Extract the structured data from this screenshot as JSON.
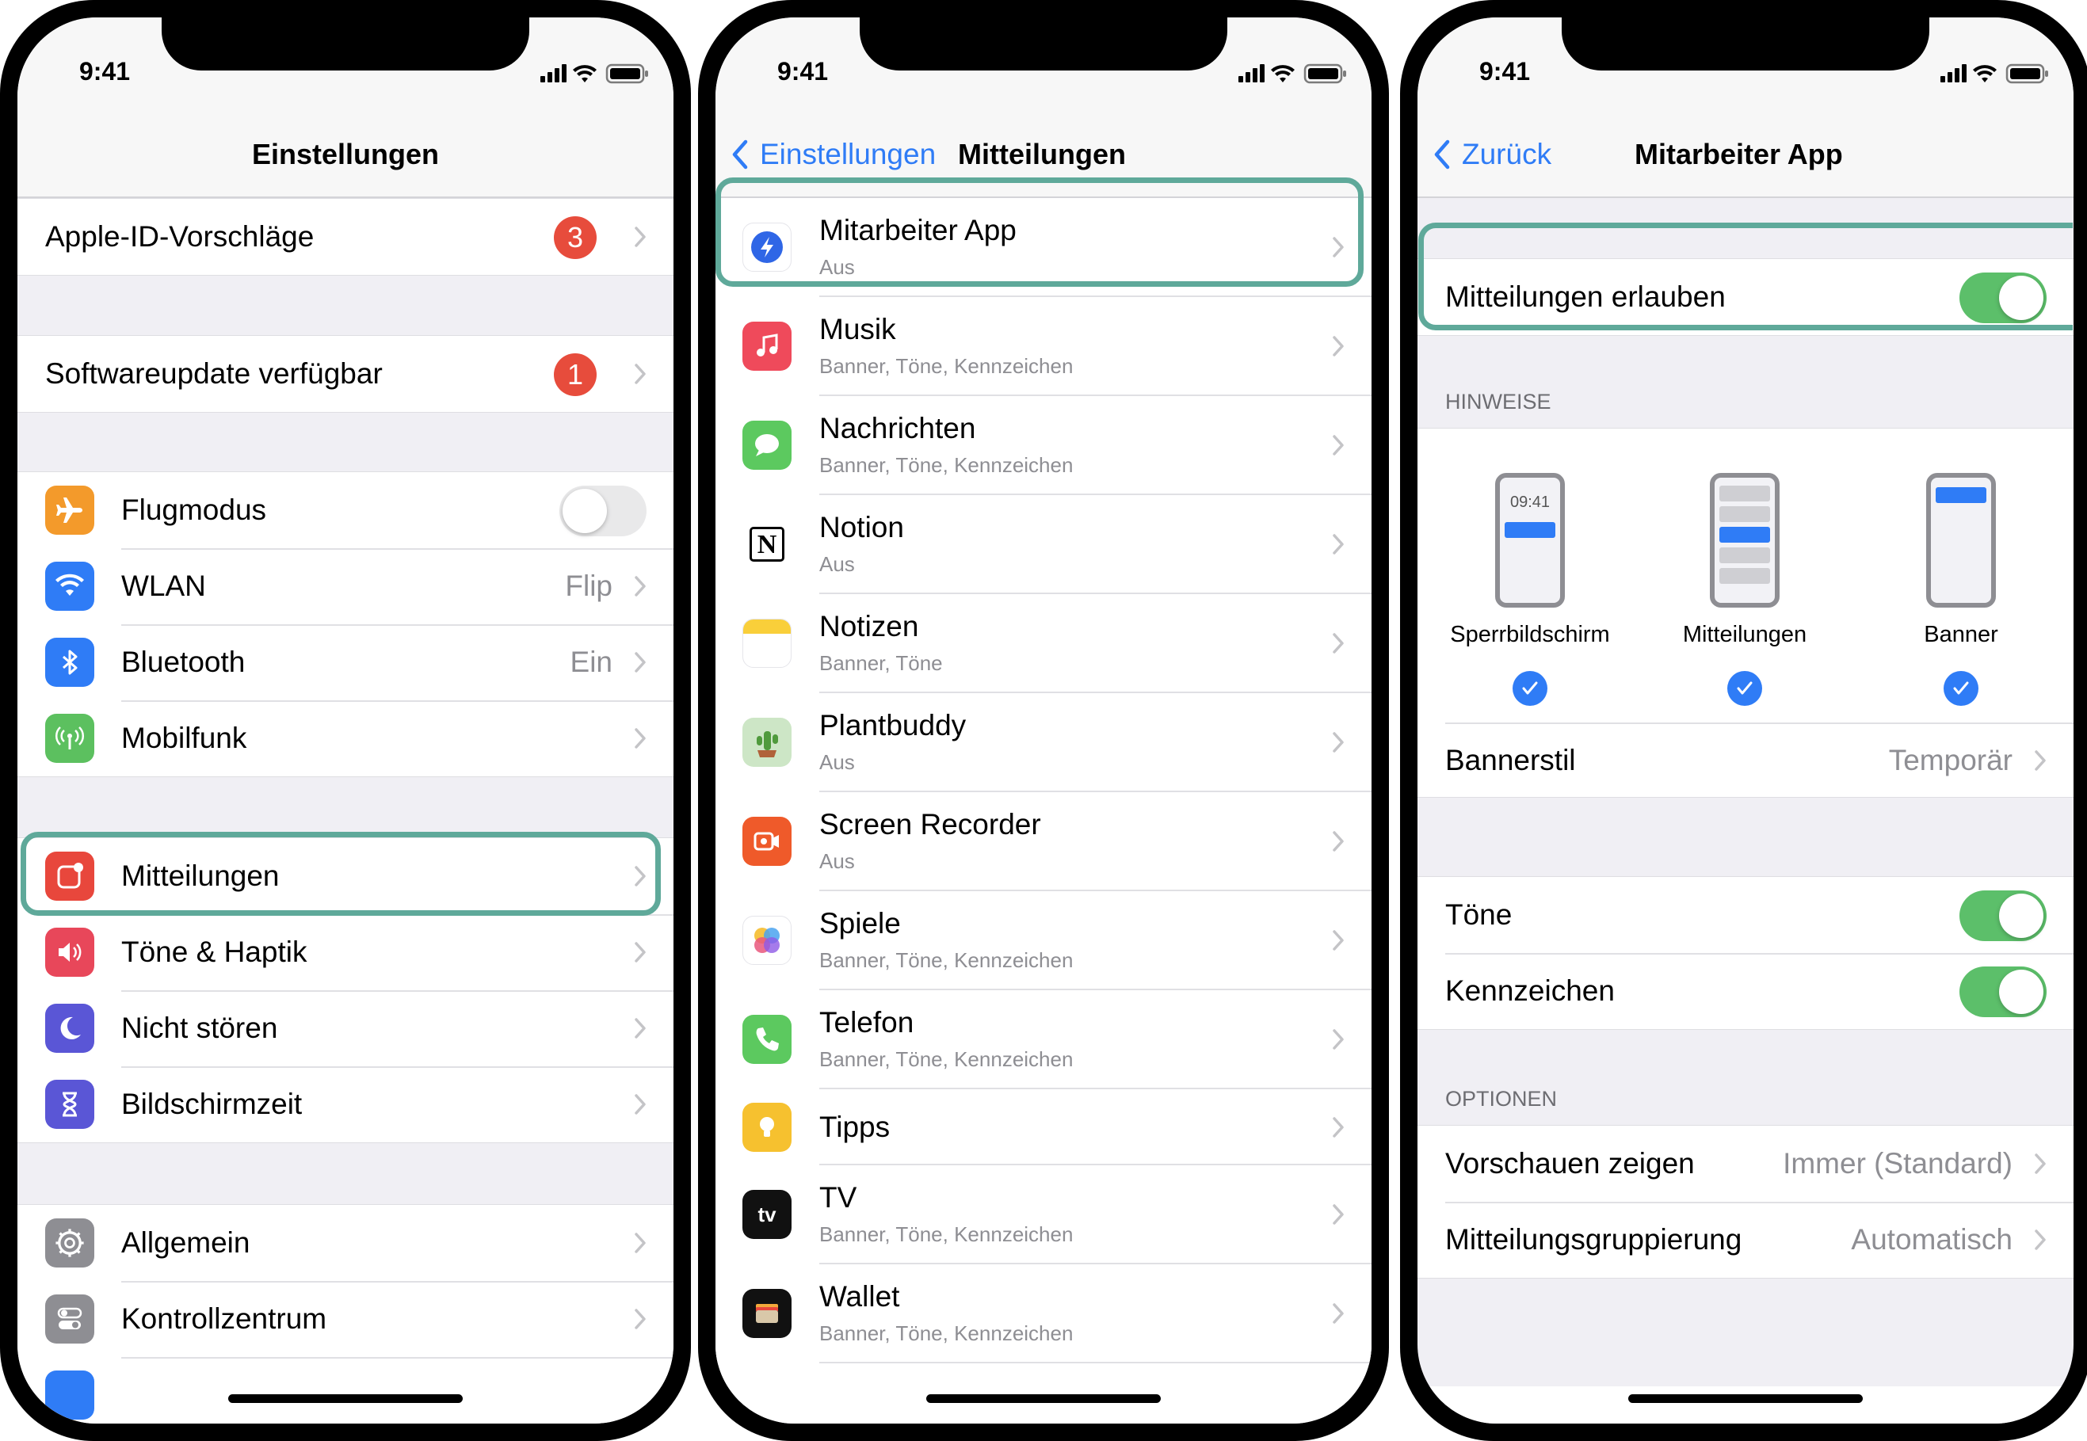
{
  "status_time": "9:41",
  "screen1": {
    "title": "Einstellungen",
    "apple_id": "Apple-ID-Vorschläge",
    "apple_id_badge": "3",
    "update": "Softwareupdate verfügbar",
    "update_badge": "1",
    "items": [
      {
        "label": "Flugmodus",
        "value": "",
        "icon": "airplane-icon"
      },
      {
        "label": "WLAN",
        "value": "Flip",
        "icon": "wifi-icon"
      },
      {
        "label": "Bluetooth",
        "value": "Ein",
        "icon": "bluetooth-icon"
      },
      {
        "label": "Mobilfunk",
        "value": "",
        "icon": "antenna-icon"
      },
      {
        "label": "Mitteilungen",
        "icon": "notifications-icon"
      },
      {
        "label": "Töne & Haptik",
        "icon": "speaker-icon"
      },
      {
        "label": "Nicht stören",
        "icon": "moon-icon"
      },
      {
        "label": "Bildschirmzeit",
        "icon": "hourglass-icon"
      },
      {
        "label": "Allgemein",
        "icon": "gear-icon"
      },
      {
        "label": "Kontrollzentrum",
        "icon": "switches-icon"
      }
    ],
    "airplane_on": false
  },
  "screen2": {
    "back": "Einstellungen",
    "title": "Mitteilungen",
    "apps": [
      {
        "name": "Mitarbeiter App",
        "sub": "Aus"
      },
      {
        "name": "Musik",
        "sub": "Banner, Töne, Kennzeichen"
      },
      {
        "name": "Nachrichten",
        "sub": "Banner, Töne, Kennzeichen"
      },
      {
        "name": "Notion",
        "sub": "Aus"
      },
      {
        "name": "Notizen",
        "sub": "Banner, Töne"
      },
      {
        "name": "Plantbuddy",
        "sub": "Aus"
      },
      {
        "name": "Screen Recorder",
        "sub": "Aus"
      },
      {
        "name": "Spiele",
        "sub": "Banner, Töne, Kennzeichen"
      },
      {
        "name": "Telefon",
        "sub": "Banner, Töne, Kennzeichen"
      },
      {
        "name": "Tipps",
        "sub": ""
      },
      {
        "name": "TV",
        "sub": "Banner, Töne, Kennzeichen"
      },
      {
        "name": "Wallet",
        "sub": "Banner, Töne, Kennzeichen"
      }
    ],
    "tv_icon_text": "tv",
    "notion_icon_text": "N"
  },
  "screen3": {
    "back": "Zurück",
    "title": "Mitarbeiter App",
    "allow": "Mitteilungen erlauben",
    "allow_on": true,
    "section_hints": "HINWEISE",
    "mock_time": "09:41",
    "styles": [
      "Sperrbildschirm",
      "Mitteilungen",
      "Banner"
    ],
    "banner_style": "Bannerstil",
    "banner_style_value": "Temporär",
    "sounds": "Töne",
    "sounds_on": true,
    "badges": "Kennzeichen",
    "badges_on": true,
    "section_options": "OPTIONEN",
    "previews": "Vorschauen zeigen",
    "previews_value": "Immer (Standard)",
    "grouping": "Mitteilungsgruppierung",
    "grouping_value": "Automatisch"
  },
  "colors": {
    "accent": "#2f7cf6",
    "highlight": "#5fa99a",
    "toggle_on": "#5cbf6a",
    "badge_red": "#e74c3c"
  }
}
